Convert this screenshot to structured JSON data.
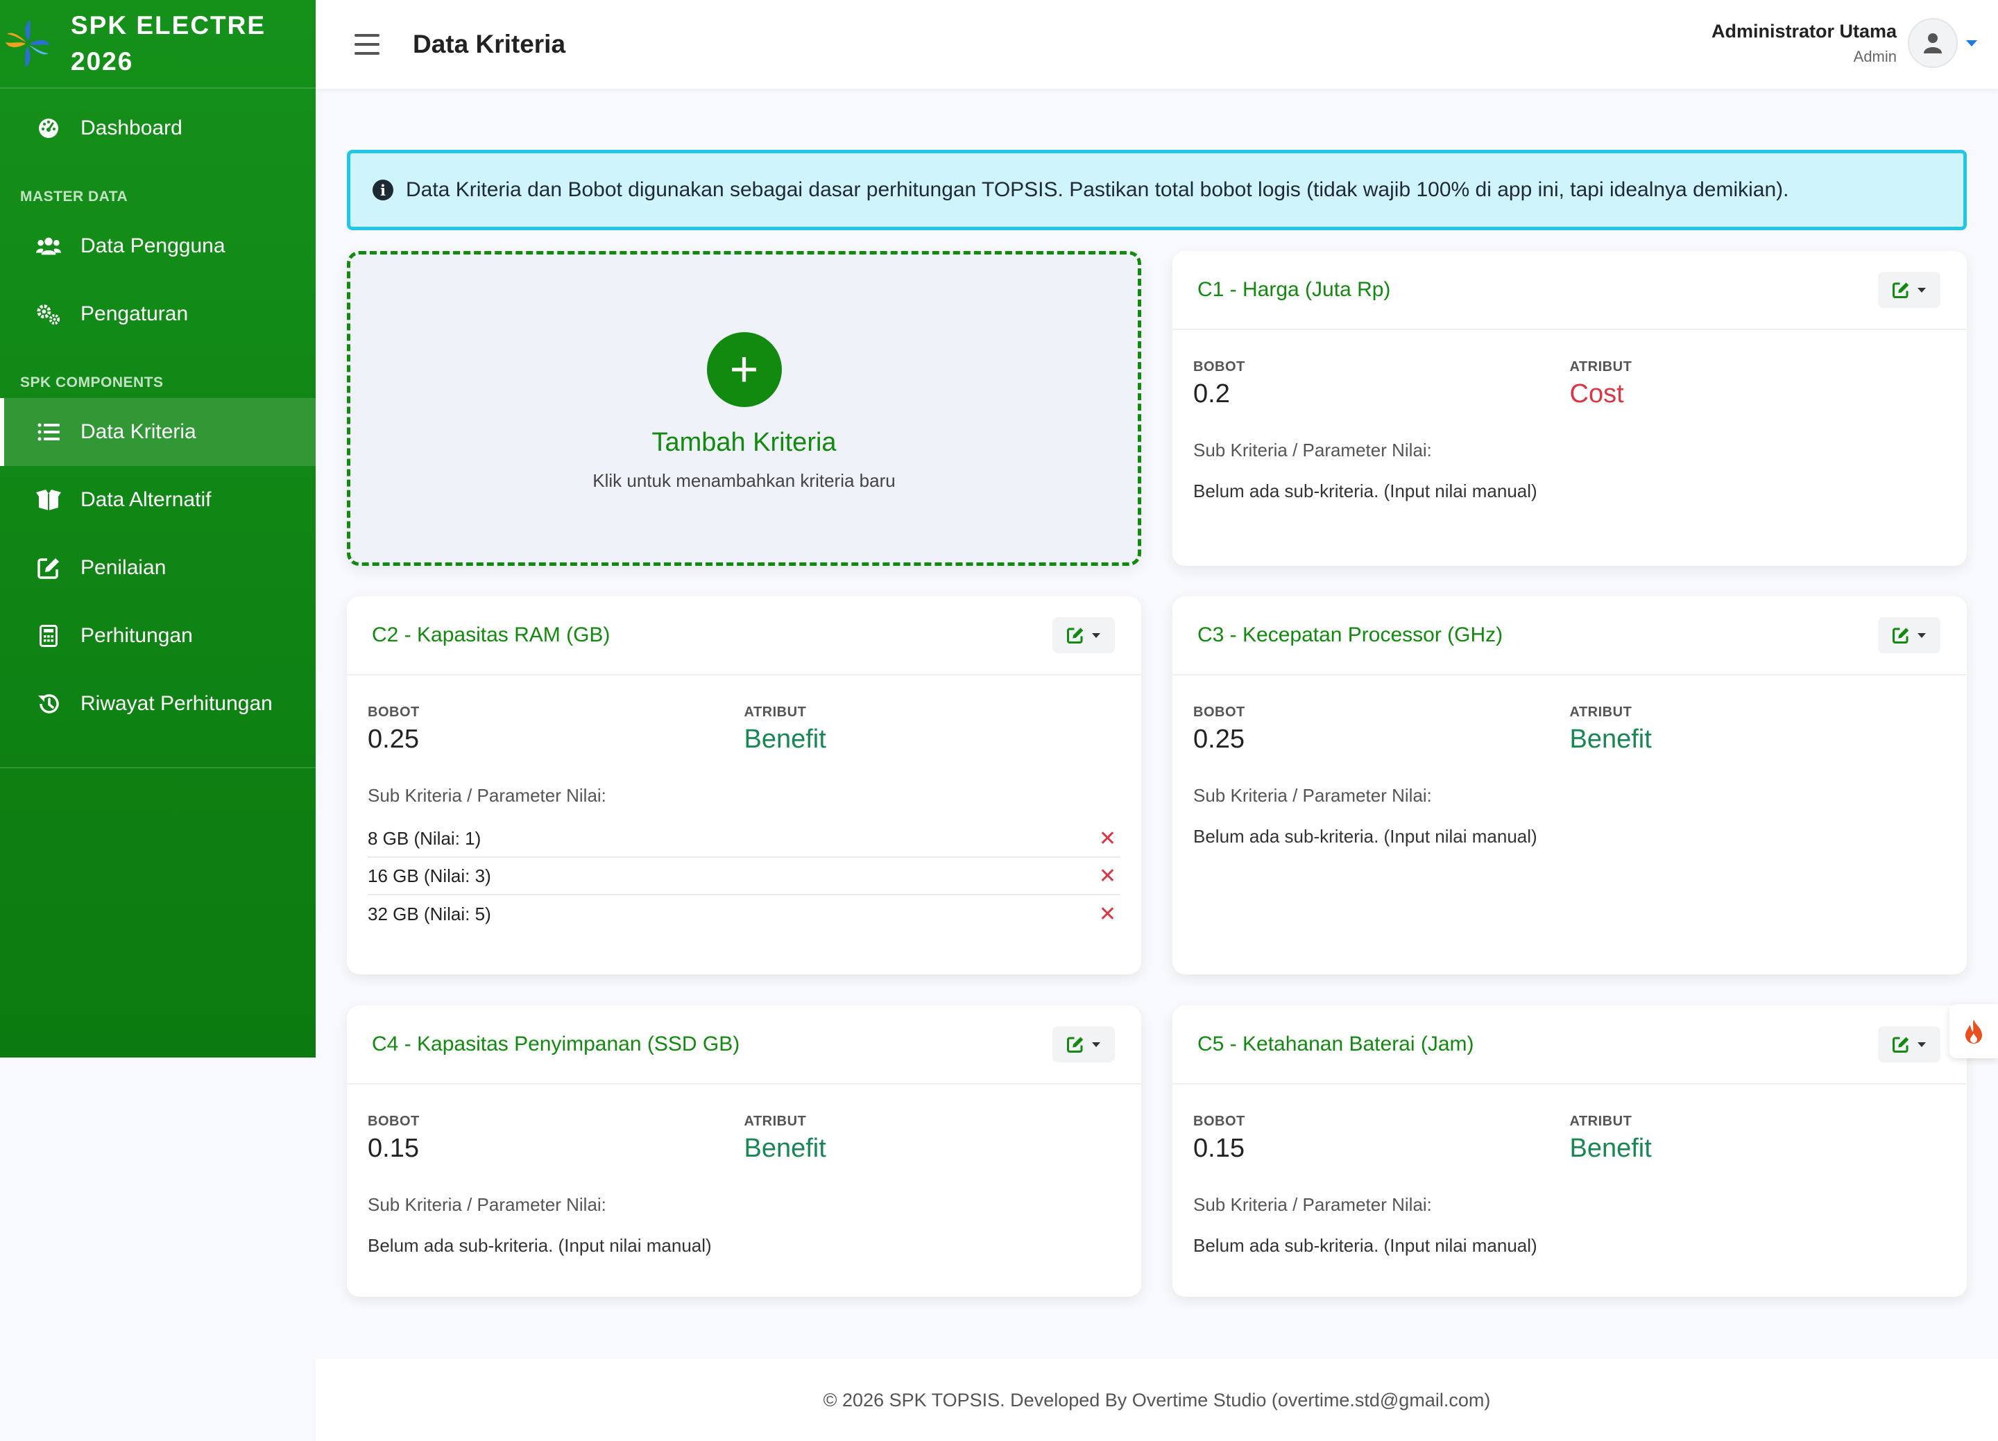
{
  "brand": {
    "line1": "SPK ELECTRE",
    "line2": "2026"
  },
  "sidebar": {
    "dashboard": {
      "label": "Dashboard",
      "icon": "gauge-icon"
    },
    "section_master": "MASTER DATA",
    "data_pengguna": {
      "label": "Data Pengguna",
      "icon": "users-icon"
    },
    "pengaturan": {
      "label": "Pengaturan",
      "icon": "gears-icon"
    },
    "section_spk": "SPK COMPONENTS",
    "data_kriteria": {
      "label": "Data Kriteria",
      "icon": "list-icon"
    },
    "data_alternatif": {
      "label": "Data Alternatif",
      "icon": "box-open-icon"
    },
    "penilaian": {
      "label": "Penilaian",
      "icon": "edit-icon"
    },
    "perhitungan": {
      "label": "Perhitungan",
      "icon": "calculator-icon"
    },
    "riwayat": {
      "label": "Riwayat Perhitungan",
      "icon": "history-icon"
    }
  },
  "topbar": {
    "title": "Data Kriteria",
    "user_name": "Administrator Utama",
    "user_role": "Admin"
  },
  "alert": {
    "text": "Data Kriteria dan Bobot digunakan sebagai dasar perhitungan TOPSIS. Pastikan total bobot logis (tidak wajib 100% di app ini, tapi idealnya demikian)."
  },
  "add_card": {
    "plus": "+",
    "title": "Tambah Kriteria",
    "subtitle": "Klik untuk menambahkan kriteria baru"
  },
  "labels": {
    "bobot": "BOBOT",
    "atribut": "ATRIBUT",
    "sub_kriteria": "Sub Kriteria / Parameter Nilai:",
    "empty_sub": "Belum ada sub-kriteria. (Input nilai manual)",
    "delete": "✕"
  },
  "kriteria": [
    {
      "title": "C1 - Harga (Juta Rp)",
      "bobot": "0.2",
      "atribut": "Cost"
    },
    {
      "title": "C2 - Kapasitas RAM (GB)",
      "bobot": "0.25",
      "atribut": "Benefit",
      "sub": [
        "8 GB (Nilai: 1)",
        "16 GB (Nilai: 3)",
        "32 GB (Nilai: 5)"
      ]
    },
    {
      "title": "C3 - Kecepatan Processor (GHz)",
      "bobot": "0.25",
      "atribut": "Benefit"
    },
    {
      "title": "C4 - Kapasitas Penyimpanan (SSD GB)",
      "bobot": "0.15",
      "atribut": "Benefit"
    },
    {
      "title": "C5 - Ketahanan Baterai (Jam)",
      "bobot": "0.15",
      "atribut": "Benefit"
    }
  ],
  "footer": "© 2026 SPK TOPSIS. Developed By Overtime Studio (overtime.std@gmail.com)",
  "colors": {
    "sidebar": "#15911a",
    "primary": "#12890f",
    "cost": "#dc3545",
    "benefit": "#198754",
    "alert_bg": "#cff4fc",
    "alert_border": "#22c7e6"
  }
}
